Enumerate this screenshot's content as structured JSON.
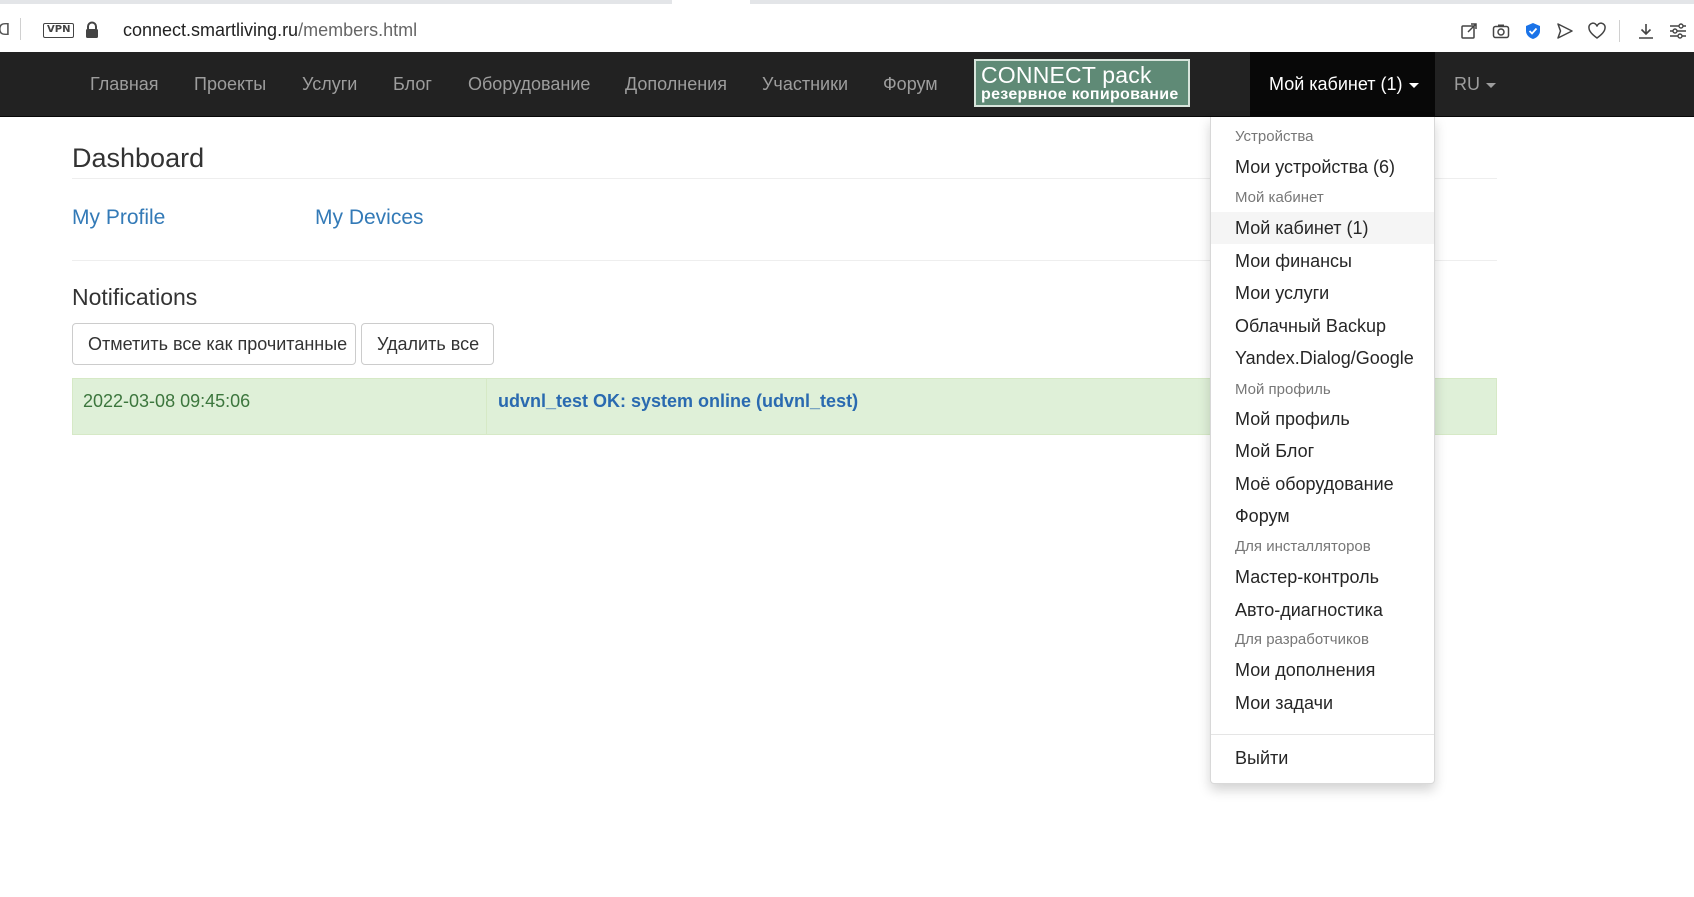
{
  "browser": {
    "vpn_label": "VPN",
    "url_host": "connect.smartliving.ru",
    "url_path": "/members.html",
    "left_glyph": "ᗡ"
  },
  "nav": {
    "items": [
      "Главная",
      "Проекты",
      "Услуги",
      "Блог",
      "Оборудование",
      "Дополнения",
      "Участники",
      "Форум"
    ],
    "brand_line1": "CONNECT pack",
    "brand_line2": "резервное копирование",
    "account_label": "Мой кабинет (1)",
    "lang_label": "RU"
  },
  "main": {
    "title": "Dashboard",
    "links": {
      "profile": "My Profile",
      "devices": "My Devices"
    },
    "notifications_title": "Notifications",
    "buttons": {
      "mark_all": "Отметить все как прочитанные",
      "delete_all": "Удалить все"
    },
    "notification": {
      "date": "2022-03-08 09:45:06",
      "message": "udvnl_test OK: system online (udvnl_test)"
    }
  },
  "dropdown": {
    "header_devices": "Устройства",
    "my_devices": "Мои устройства (6)",
    "header_cabinet": "Мой кабинет",
    "my_cabinet": "Мой кабинет (1)",
    "my_finances": "Мои финансы",
    "my_services": "Мои услуги",
    "cloud_backup": "Облачный Backup",
    "yandex_google": "Yandex.Dialog/Google",
    "header_profile": "Мой профиль",
    "my_profile": "Мой профиль",
    "my_blog": "Мой Блог",
    "my_equipment": "Моё оборудование",
    "forum": "Форум",
    "header_installers": "Для инсталляторов",
    "master_control": "Мастер-контроль",
    "auto_diag": "Авто-диагностика",
    "header_developers": "Для разработчиков",
    "my_addons": "Мои дополнения",
    "my_tasks": "Мои задачи",
    "logout": "Выйти"
  },
  "colors": {
    "navbar_bg": "#222222",
    "link": "#337ab7",
    "success_bg": "#dff0d8",
    "brand_green": "#5f8a76"
  }
}
